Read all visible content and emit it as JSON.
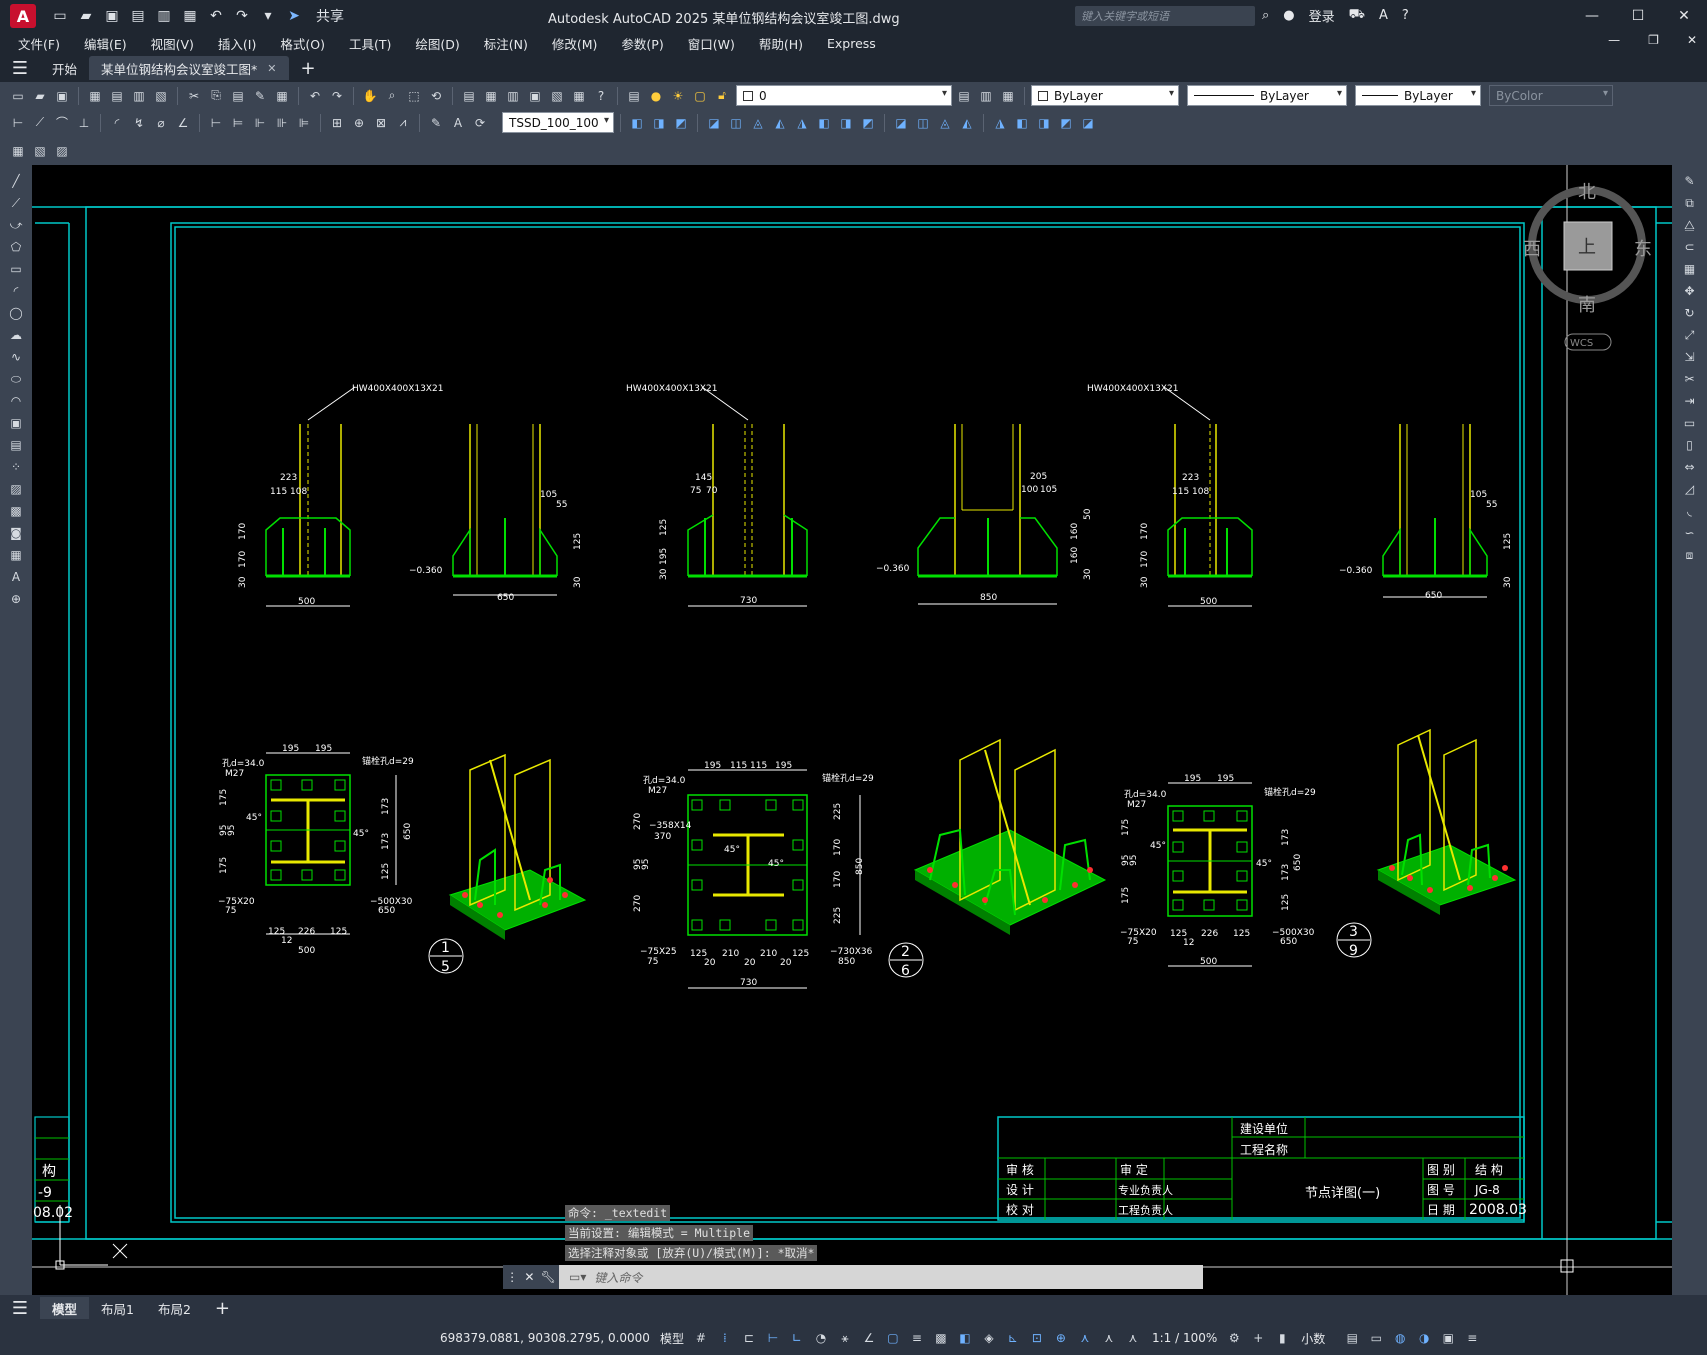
{
  "app": {
    "logo": "A",
    "title": "Autodesk AutoCAD 2025    某单位钢结构会议室竣工图.dwg",
    "share_label": "共享",
    "search_placeholder": "键入关键字或短语",
    "login_label": "登录"
  },
  "menu": {
    "items": [
      "文件(F)",
      "编辑(E)",
      "视图(V)",
      "插入(I)",
      "格式(O)",
      "工具(T)",
      "绘图(D)",
      "标注(N)",
      "修改(M)",
      "参数(P)",
      "窗口(W)",
      "帮助(H)",
      "Express"
    ]
  },
  "tabs": {
    "start": "开始",
    "drawing": "某单位钢结构会议室竣工图*"
  },
  "toolbar": {
    "layer_value": "0",
    "color_value": "ByLayer",
    "linetype_value": "ByLayer",
    "lineweight_value": "ByLayer",
    "plotstyle_value": "ByColor",
    "dimstyle_value": "TSSD_100_100"
  },
  "viewcube": {
    "north": "北",
    "south": "南",
    "east": "东",
    "west": "西",
    "face": "上",
    "wcs": "WCS"
  },
  "drawing": {
    "member_label": "HW400X400X13X21",
    "elevation": "−0.360",
    "widths": [
      "500",
      "650",
      "730",
      "850",
      "500",
      "650"
    ],
    "dims_a": [
      "223",
      "115",
      "108",
      "170",
      "170",
      "30"
    ],
    "dims_b": [
      "105",
      "55",
      "125",
      "30"
    ],
    "dims_c": [
      "145",
      "75",
      "70",
      "125",
      "195",
      "30"
    ],
    "dims_d": [
      "205",
      "100",
      "105",
      "50",
      "160",
      "160",
      "30"
    ],
    "plan_top": [
      "195",
      "195"
    ],
    "plan_top_b": [
      "195",
      "115",
      "115",
      "195"
    ],
    "bolt_hole": "锚栓孔d=29",
    "hole_label": "孔d=34.0",
    "bolt_size": "M27",
    "angle": "45°",
    "plan_a_bottom": [
      "125",
      "226",
      "125"
    ],
    "plan_a_sub": "12",
    "plate_a": "−500X30",
    "stiff_a": "−75X20",
    "stiff_b": "−75X25",
    "plate_b": "−730X36",
    "stiff_c": "−358X14",
    "plan_b_bottom": [
      "125",
      "210",
      "210",
      "125"
    ],
    "plan_b_sub": [
      "20",
      "20",
      "20"
    ],
    "plan_b_left": [
      "270",
      "370",
      "95",
      "95",
      "270"
    ],
    "plan_b_right": [
      "225",
      "170",
      "170",
      "225"
    ],
    "plan_b_total": "850",
    "plan_a_left": [
      "175",
      "95",
      "95",
      "175"
    ],
    "plan_a_right": [
      "173",
      "173",
      "125"
    ],
    "plan_a_total": "650",
    "sub_75": "75",
    "plate_a_sub": "650",
    "plate_b_sub": "850",
    "callouts": [
      {
        "top": "1",
        "bottom": "5"
      },
      {
        "top": "2",
        "bottom": "6"
      },
      {
        "top": "3",
        "bottom": "9"
      }
    ]
  },
  "title_block": {
    "client_label": "建设单位",
    "project_label": "工程名称",
    "review": "审  核",
    "approve": "审  定",
    "design": "设  计",
    "major_lead": "专业负责人",
    "check": "校  对",
    "project_lead": "工程负责人",
    "drawing_title": "节点详图(一)",
    "category_label": "图  别",
    "category_value": "结  构",
    "number_label": "图  号",
    "number_value": "JG-8",
    "date_label": "日  期",
    "date_value": "2008.03",
    "left_partial": [
      "构",
      "-9",
      "08.02"
    ]
  },
  "command": {
    "history": [
      "命令: _textedit",
      "当前设置: 编辑模式 = Multiple",
      "选择注释对象或 [放弃(U)/模式(M)]: *取消*"
    ],
    "placeholder": "键入命令"
  },
  "layout_tabs": [
    "模型",
    "布局1",
    "布局2"
  ],
  "status": {
    "coords": "698379.0881, 90308.2795, 0.0000",
    "space": "模型",
    "scale": "1:1 / 100%",
    "units": "小数"
  }
}
